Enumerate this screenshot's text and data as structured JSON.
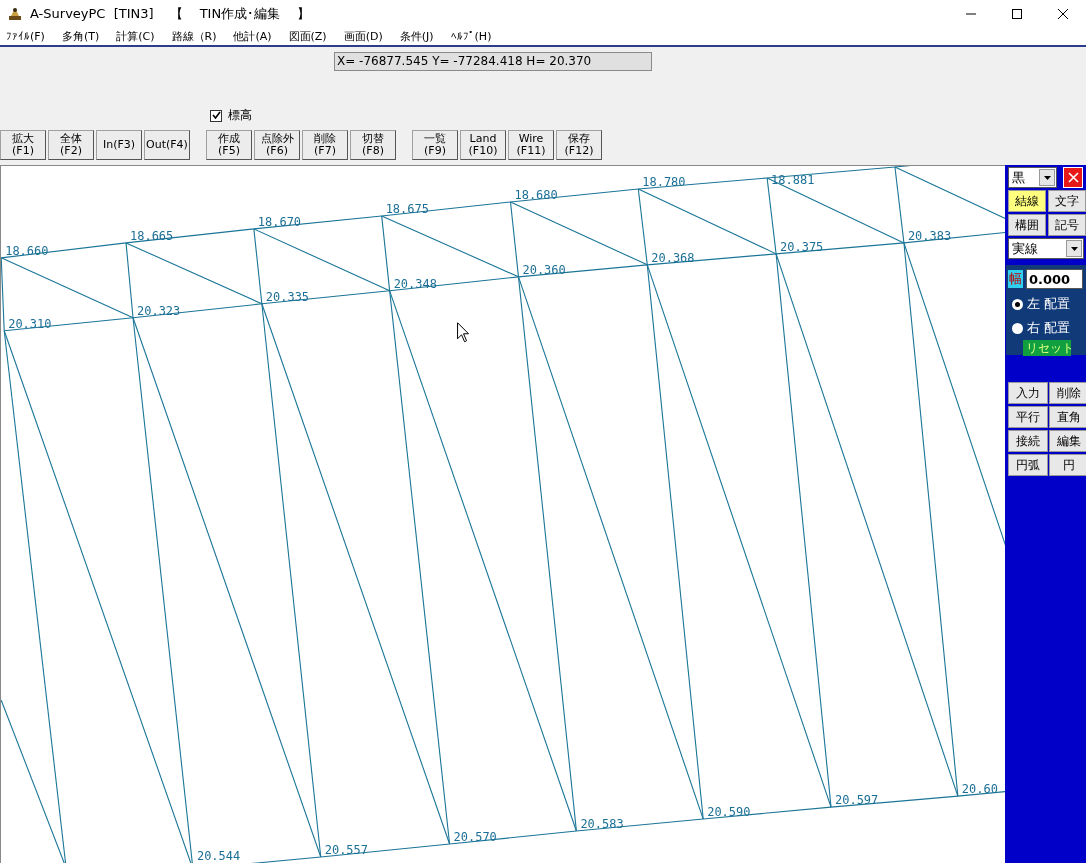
{
  "window": {
    "title": "A-SurveyPC  [TIN3]    【    TIN作成･編集    】"
  },
  "menu": [
    "ﾌｧｲﾙ(F)",
    "多角(T)",
    "計算(C)",
    "路線（R)",
    "他計(A)",
    "図面(Z)",
    "画面(D)",
    "条件(J)",
    "ﾍﾙﾌﾟ(H)"
  ],
  "coordinate_readout": "X= -76877.545  Y= -77284.418  H= 20.370",
  "elevation_checkbox": {
    "label": "標高",
    "checked": true
  },
  "toolbar": [
    [
      {
        "label": "拡大",
        "key": "(F1)"
      },
      {
        "label": "全体",
        "key": "(F2)"
      },
      {
        "label": "In(F3)"
      },
      {
        "label": "Out(F4)"
      }
    ],
    [
      {
        "label": "作成",
        "key": "(F5)"
      },
      {
        "label": "点除外",
        "key": "(F6)"
      },
      {
        "label": "削除",
        "key": "(F7)"
      },
      {
        "label": "切替",
        "key": "(F8)"
      }
    ],
    [
      {
        "label": "一覧",
        "key": "(F9)"
      },
      {
        "label": "Land",
        "key": "(F10)"
      },
      {
        "label": "Wire",
        "key": "(F11)"
      },
      {
        "label": "保存",
        "key": "(F12)"
      }
    ]
  ],
  "tin": {
    "top_row": [
      "18.660",
      "18.665",
      "18.670",
      "18.675",
      "18.680",
      "18.780",
      "18.881"
    ],
    "middle_row": [
      "20.310",
      "20.323",
      "20.335",
      "20.348",
      "20.360",
      "20.368",
      "20.375",
      "20.383"
    ],
    "bottom_row": [
      "20.544",
      "20.557",
      "20.570",
      "20.583",
      "20.590",
      "20.597",
      "20.60"
    ]
  },
  "side_panel": {
    "color_select": "黒",
    "mode_buttons": [
      {
        "label": "結線",
        "selected": true
      },
      {
        "label": "文字",
        "selected": false
      },
      {
        "label": "構囲",
        "selected": false
      },
      {
        "label": "記号",
        "selected": false
      }
    ],
    "line_style": "実線",
    "width_label": "幅",
    "width_value": "0.000",
    "placement": [
      {
        "label": "左 配置",
        "selected": true
      },
      {
        "label": "右 配置",
        "selected": false
      }
    ],
    "reset": "リセット",
    "edit_buttons": [
      "入力",
      "削除",
      "平行",
      "直角",
      "接続",
      "編集",
      "円弧",
      "円"
    ]
  }
}
